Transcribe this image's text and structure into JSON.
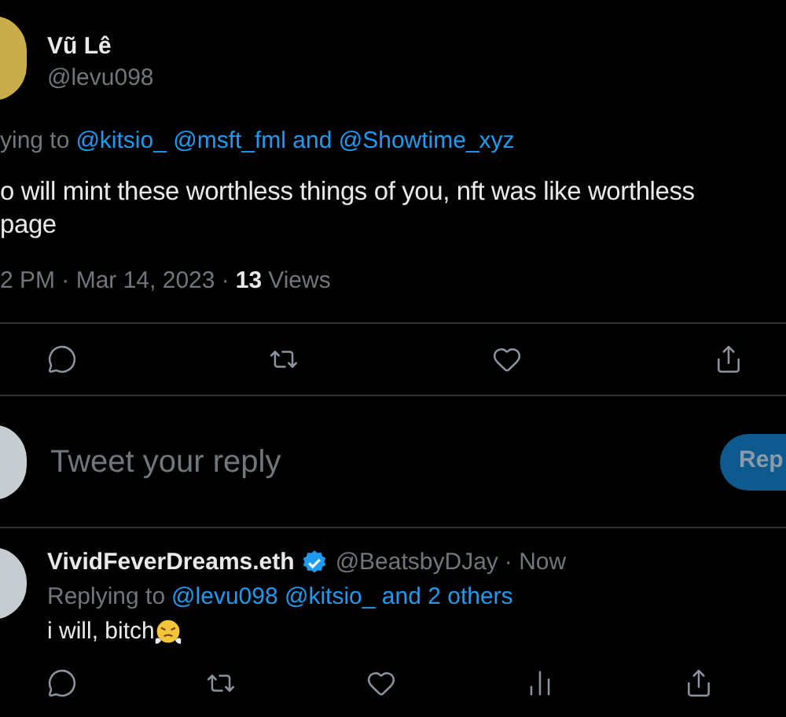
{
  "tweet": {
    "author": {
      "name": "Vũ Lê",
      "handle": "@levu098"
    },
    "replying": {
      "prefix": "ying to",
      "mentions": "@kitsio_ @msft_fml and @Showtime_xyz"
    },
    "body_lines": [
      "o will mint these worthless things of you, nft was like worthless",
      "page"
    ],
    "meta": {
      "time": "2 PM · Mar 14, 2023 ·",
      "views_count": "13",
      "views_label": "Views"
    },
    "actions": [
      {
        "kind": "reply"
      },
      {
        "kind": "retweet"
      },
      {
        "kind": "like"
      },
      {
        "kind": "share"
      }
    ]
  },
  "composer": {
    "placeholder": "Tweet your reply",
    "button": "Rep"
  },
  "reply": {
    "author": {
      "name": "VividFeverDreams.eth",
      "verified": true,
      "handle": "@BeatsbyDJay",
      "time": "· Now"
    },
    "replying": {
      "prefix": "Replying to",
      "mentions": "@levu098 @kitsio_ and 2 others"
    },
    "body": "i will, bitch",
    "actions": [
      {
        "kind": "reply"
      },
      {
        "kind": "retweet"
      },
      {
        "kind": "like"
      },
      {
        "kind": "views"
      },
      {
        "kind": "share"
      }
    ]
  }
}
